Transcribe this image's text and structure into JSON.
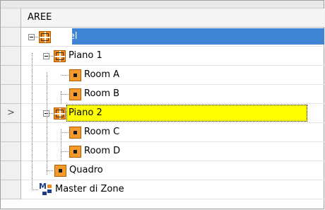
{
  "header": {
    "column_title": "AREE"
  },
  "tree": {
    "nodes": [
      {
        "label": "Hotel",
        "icon": "group-icon",
        "state": "selected"
      },
      {
        "label": "Piano 1",
        "icon": "group-icon"
      },
      {
        "label": "Room A",
        "icon": "room-icon"
      },
      {
        "label": "Room B",
        "icon": "room-icon"
      },
      {
        "label": "Piano 2",
        "icon": "group-icon",
        "state": "current"
      },
      {
        "label": "Room C",
        "icon": "room-icon"
      },
      {
        "label": "Room D",
        "icon": "room-icon"
      },
      {
        "label": "Quadro",
        "icon": "room-icon"
      },
      {
        "label": "Master di Zone",
        "icon": "master-zone-icon"
      }
    ]
  },
  "row_indicator": {
    "symbol": ">",
    "row": 5
  },
  "colors": {
    "selection": "#3f84d4",
    "current_highlight": "#ffff00",
    "icon_orange": "#f08a1a",
    "master_blue": "#1a3a8a"
  }
}
